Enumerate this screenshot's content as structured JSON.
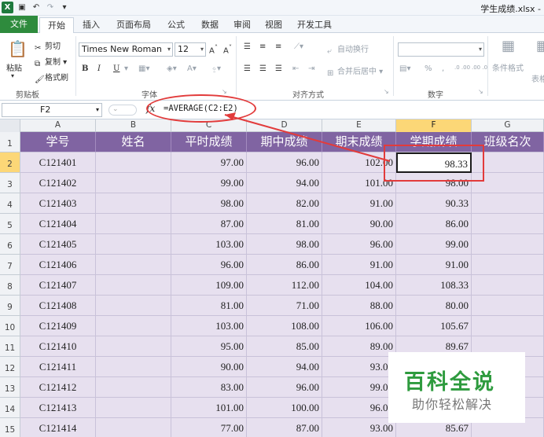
{
  "window": {
    "title": "学生成绩.xlsx -",
    "app_icon": "X"
  },
  "ribbon": {
    "tabs": [
      {
        "label": "文件",
        "kind": "file"
      },
      {
        "label": "开始",
        "kind": "active"
      },
      {
        "label": "插入"
      },
      {
        "label": "页面布局"
      },
      {
        "label": "公式"
      },
      {
        "label": "数据"
      },
      {
        "label": "审阅"
      },
      {
        "label": "视图"
      },
      {
        "label": "开发工具"
      }
    ],
    "clipboard": {
      "paste": "粘贴",
      "cut": "剪切",
      "copy": "复制",
      "format_painter": "格式刷",
      "group_label": "剪贴板"
    },
    "font": {
      "name": "Times New Roman",
      "size": "12",
      "bold": "B",
      "italic": "I",
      "underline": "U",
      "font_color": "A",
      "phonetic": "wén",
      "group_label": "字体"
    },
    "alignment": {
      "wrap": "自动换行",
      "merge": "合并后居中",
      "group_label": "对齐方式"
    },
    "number": {
      "percent": "%",
      "comma": ",",
      "inc_dec": ".0 .00",
      "dec_dec": ".00 .0",
      "group_label": "数字"
    },
    "styles": {
      "conditional": "条件格式",
      "table": "表格"
    }
  },
  "formula_bar": {
    "name_box": "F2",
    "fx": "fx",
    "formula": "=AVERAGE(C2:E2)"
  },
  "sheet": {
    "columns": [
      "A",
      "B",
      "C",
      "D",
      "E",
      "F",
      "G"
    ],
    "selected_column": "F",
    "headers": [
      "学号",
      "姓名",
      "平时成绩",
      "期中成绩",
      "期末成绩",
      "学期成绩",
      "班级名次"
    ],
    "rows": [
      {
        "n": "2",
        "id": "C121401",
        "c": "97.00",
        "d": "96.00",
        "e": "102.00",
        "f": "98.33"
      },
      {
        "n": "3",
        "id": "C121402",
        "c": "99.00",
        "d": "94.00",
        "e": "101.00",
        "f": "98.00"
      },
      {
        "n": "4",
        "id": "C121403",
        "c": "98.00",
        "d": "82.00",
        "e": "91.00",
        "f": "90.33"
      },
      {
        "n": "5",
        "id": "C121404",
        "c": "87.00",
        "d": "81.00",
        "e": "90.00",
        "f": "86.00"
      },
      {
        "n": "6",
        "id": "C121405",
        "c": "103.00",
        "d": "98.00",
        "e": "96.00",
        "f": "99.00"
      },
      {
        "n": "7",
        "id": "C121406",
        "c": "96.00",
        "d": "86.00",
        "e": "91.00",
        "f": "91.00"
      },
      {
        "n": "8",
        "id": "C121407",
        "c": "109.00",
        "d": "112.00",
        "e": "104.00",
        "f": "108.33"
      },
      {
        "n": "9",
        "id": "C121408",
        "c": "81.00",
        "d": "71.00",
        "e": "88.00",
        "f": "80.00"
      },
      {
        "n": "10",
        "id": "C121409",
        "c": "103.00",
        "d": "108.00",
        "e": "106.00",
        "f": "105.67"
      },
      {
        "n": "11",
        "id": "C121410",
        "c": "95.00",
        "d": "85.00",
        "e": "89.00",
        "f": "89.67"
      },
      {
        "n": "12",
        "id": "C121411",
        "c": "90.00",
        "d": "94.00",
        "e": "93.00",
        "f": ""
      },
      {
        "n": "13",
        "id": "C121412",
        "c": "83.00",
        "d": "96.00",
        "e": "99.00",
        "f": ""
      },
      {
        "n": "14",
        "id": "C121413",
        "c": "101.00",
        "d": "100.00",
        "e": "96.00",
        "f": ""
      },
      {
        "n": "15",
        "id": "C121414",
        "c": "77.00",
        "d": "87.00",
        "e": "93.00",
        "f": "85.67"
      }
    ],
    "header_row_number": "1",
    "active_row": "2"
  },
  "watermark": {
    "title": "百科全说",
    "subtitle": "助你轻松解决"
  },
  "colors": {
    "header_fill": "#8064a2",
    "body_fill": "#e7e0ef",
    "annotation": "#e23b3b",
    "file_tab": "#2e8b3d"
  }
}
